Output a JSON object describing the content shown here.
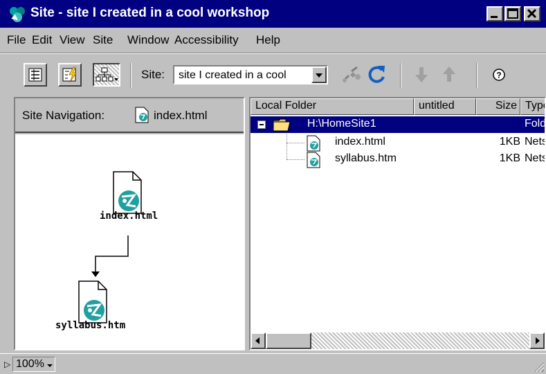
{
  "window": {
    "title": "Site - site I created in a cool workshop"
  },
  "menu": [
    {
      "label": "File"
    },
    {
      "label": "Edit"
    },
    {
      "label": "View"
    },
    {
      "label": "Site"
    },
    {
      "label": "Window"
    },
    {
      "label": "Accessibility"
    },
    {
      "label": "Help"
    }
  ],
  "toolbar": {
    "site_label": "Site:",
    "site_value": "site I created in a cool"
  },
  "navigation": {
    "header_label": "Site Navigation:",
    "header_file": "index.html",
    "nodes": [
      {
        "label": "index.html"
      },
      {
        "label": "syllabus.htm"
      }
    ]
  },
  "file_list": {
    "columns": [
      "Local Folder",
      "untitled",
      "Size",
      "Type"
    ],
    "rows": [
      {
        "name": "H:\\HomeSite1",
        "size": "",
        "type": "Folder",
        "selected": true
      },
      {
        "name": "index.html",
        "size": "1KB",
        "type": "Netscape"
      },
      {
        "name": "syllabus.htm",
        "size": "1KB",
        "type": "Netscape"
      }
    ]
  },
  "status": {
    "zoom": "100%"
  },
  "colors": {
    "titlebar": "#000080",
    "selection": "#000080",
    "face": "#c0c0c0"
  }
}
